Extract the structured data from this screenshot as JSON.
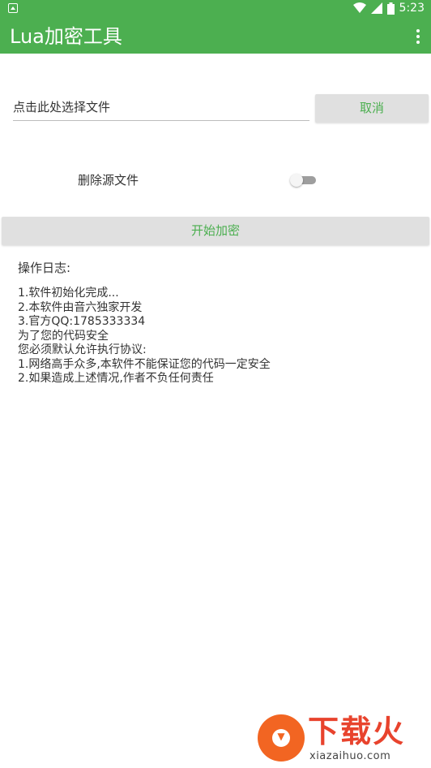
{
  "status_bar": {
    "time": "5:23",
    "icons": [
      "notification-icon",
      "wifi-icon",
      "signal-icon",
      "battery-icon"
    ]
  },
  "toolbar": {
    "title": "Lua加密工具",
    "menu_icon": "more-vert-icon"
  },
  "file_select": {
    "placeholder": "点击此处选择文件",
    "cancel_label": "取消"
  },
  "options": {
    "delete_source_label": "删除源文件",
    "delete_source_enabled": false
  },
  "actions": {
    "start_label": "开始加密"
  },
  "log": {
    "title": "操作日志:",
    "lines": [
      "1.软件初始化完成...",
      "2.本软件由音六独家开发",
      "3.官方QQ:1785333334",
      "为了您的代码安全",
      "您必须默认允许执行协议:",
      "1.网络高手众多,本软件不能保证您的代码一定安全",
      "2.如果造成上述情况,作者不负任何责任"
    ]
  },
  "watermark": {
    "text": "下载火",
    "domain": "xiazaihuo.com"
  },
  "colors": {
    "primary": "#4caf50",
    "button_bg": "#e0e0e0",
    "watermark": "#e8432d"
  }
}
